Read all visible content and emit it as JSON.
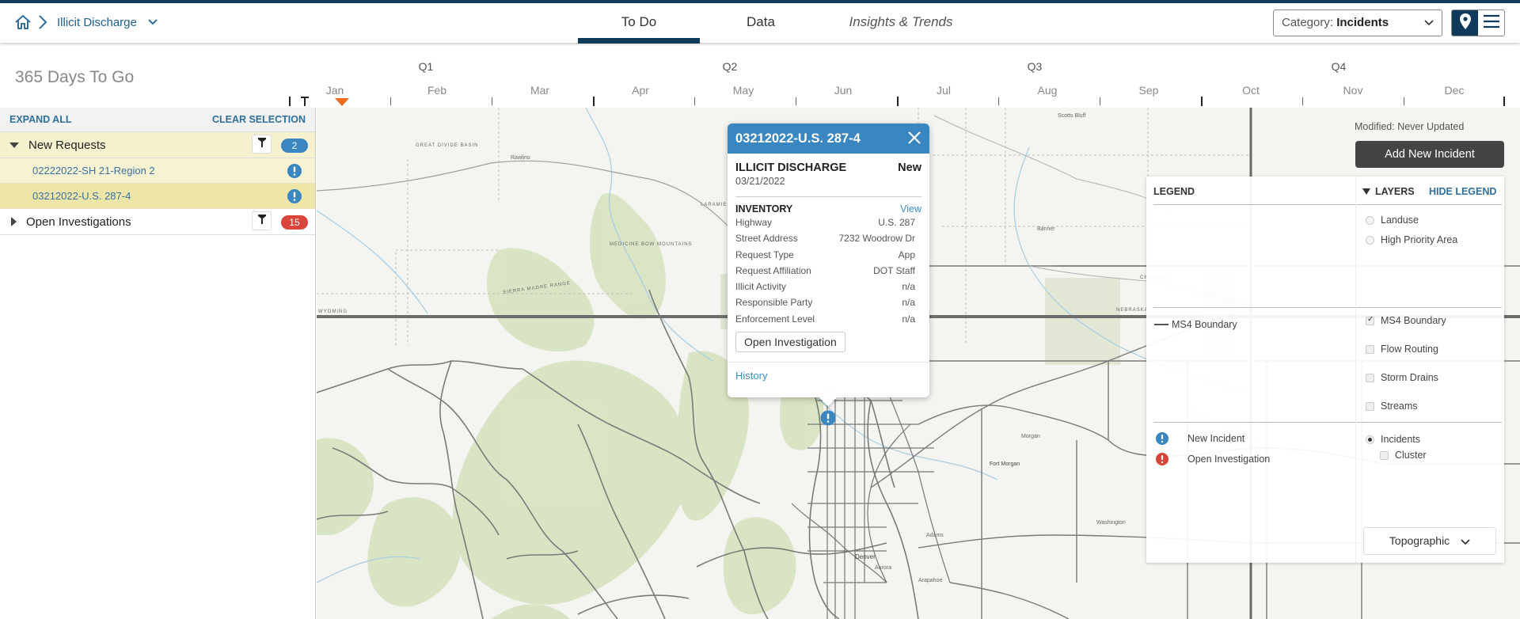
{
  "header": {
    "breadcrumb": {
      "home_icon": "home-icon",
      "separator_icon": "chevron-right-icon",
      "module": "Illicit Discharge",
      "dropdown_icon": "chevron-down-icon"
    },
    "tabs": [
      {
        "label": "To Do",
        "active": true
      },
      {
        "label": "Data",
        "active": false
      },
      {
        "label": "Insights & Trends",
        "active": false
      }
    ],
    "category_select": {
      "prefix": "Category:",
      "value": "Incidents"
    },
    "view_toggle": {
      "map_icon": "map-pin-icon",
      "list_icon": "menu-icon",
      "active": "map"
    }
  },
  "timeline": {
    "days_to_go": "365 Days To Go",
    "quarters": [
      "Q1",
      "Q2",
      "Q3",
      "Q4"
    ],
    "months": [
      "Jan",
      "Feb",
      "Mar",
      "Apr",
      "May",
      "Jun",
      "Jul",
      "Aug",
      "Sep",
      "Oct",
      "Nov",
      "Dec"
    ],
    "current_marker_color": "#f26a1b"
  },
  "sidebar": {
    "expand_all": "EXPAND ALL",
    "clear_selection": "CLEAR SELECTION",
    "groups": [
      {
        "label": "New Requests",
        "expanded": true,
        "count": "2",
        "badge_color": "#3a86c0",
        "items": [
          {
            "label": "02222022-SH 21-Region 2",
            "selected": false
          },
          {
            "label": "03212022-U.S. 287-4",
            "selected": true
          }
        ]
      },
      {
        "label": "Open Investigations",
        "expanded": false,
        "count": "15",
        "badge_color": "#d9453b",
        "items": []
      }
    ]
  },
  "popup": {
    "title": "03212022-U.S. 287-4",
    "type": "ILLICIT DISCHARGE",
    "status": "New",
    "date": "03/21/2022",
    "inventory_label": "INVENTORY",
    "view_link": "View",
    "fields": [
      {
        "label": "Highway",
        "value": "U.S. 287"
      },
      {
        "label": "Street Address",
        "value": "7232 Woodrow Dr"
      },
      {
        "label": "Request Type",
        "value": "App"
      },
      {
        "label": "Request Affiliation",
        "value": "DOT Staff"
      },
      {
        "label": "Illicit Activity",
        "value": "n/a"
      },
      {
        "label": "Responsible Party",
        "value": "n/a"
      },
      {
        "label": "Enforcement Level",
        "value": "n/a"
      }
    ],
    "action_button": "Open Investigation",
    "history_link": "History"
  },
  "map_panel": {
    "modified": "Modified: Never Updated",
    "add_button": "Add New Incident"
  },
  "legend": {
    "title": "LEGEND",
    "layers_title": "LAYERS",
    "hide_legend": "HIDE LEGEND",
    "ms4_boundary": "MS4 Boundary",
    "new_incident": "New Incident",
    "open_investigation": "Open Investigation",
    "new_color": "#3a86c0",
    "open_color": "#d9453b",
    "layer_radios_top": [
      {
        "label": "Landuse",
        "checked": false
      },
      {
        "label": "High Priority Area",
        "checked": false
      }
    ],
    "layer_checks": [
      {
        "label": "MS4 Boundary",
        "checked": true
      },
      {
        "label": "Flow Routing",
        "checked": false
      },
      {
        "label": "Storm Drains",
        "checked": false
      },
      {
        "label": "Streams",
        "checked": false
      }
    ],
    "incidents_radio": {
      "label": "Incidents",
      "checked": true
    },
    "cluster_check": {
      "label": "Cluster",
      "checked": false
    },
    "basemap": "Topographic"
  },
  "map_labels": {
    "great_divide": "GREAT DIVIDE BASIN",
    "rawlins": "Rawlins",
    "laramie": "LARAMIE",
    "medicine_bow": "MEDICINE BOW MOUNTAINS",
    "sierra_madre": "SIERRA MADRE RANGE",
    "wyoming": "WYOMING",
    "nebraska": "NEBRASKA",
    "denver": "Denver",
    "aurora": "Aurora",
    "fort_morgan": "Fort Morgan",
    "morgan": "Morgan",
    "adams": "Adams",
    "arapahoe": "Arapahoe",
    "washington": "Washington",
    "scotts_bluff": "Scotts Bluff",
    "banner": "Banner",
    "cheyenne": "Cheyenne"
  }
}
